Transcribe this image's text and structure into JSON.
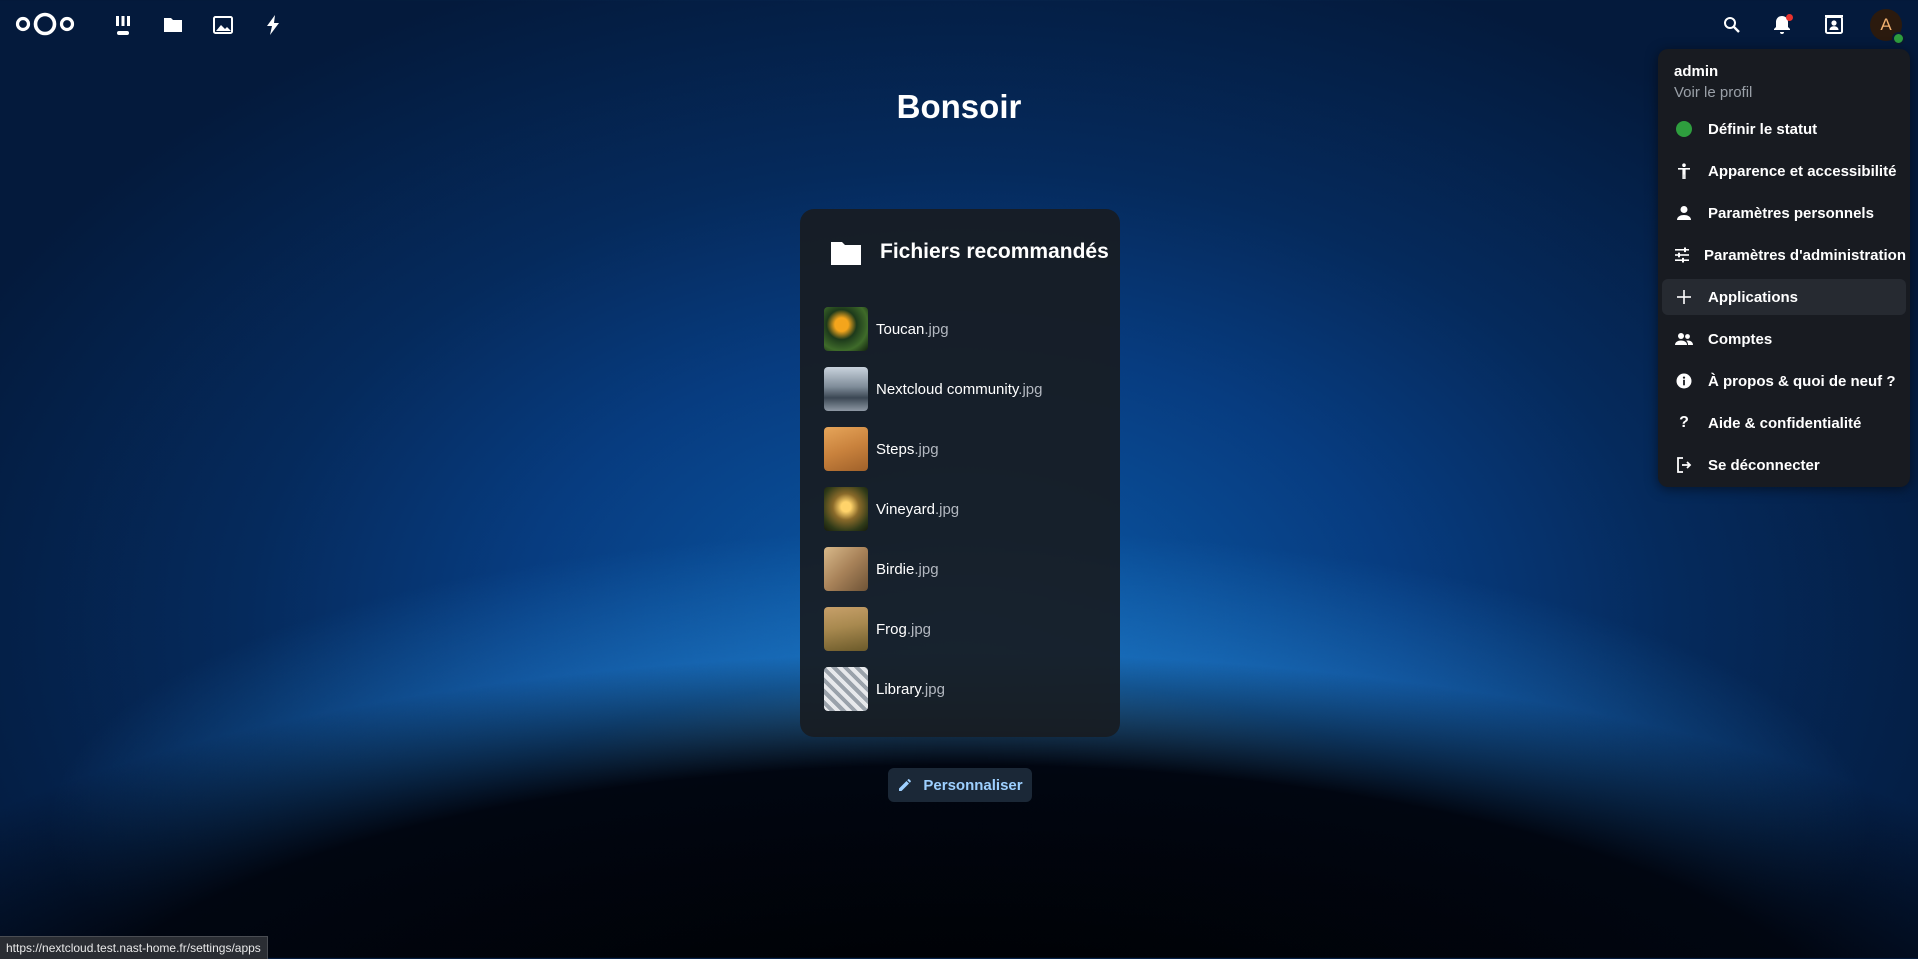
{
  "topbar": {
    "nav": [
      {
        "name": "dashboard-icon"
      },
      {
        "name": "files-icon"
      },
      {
        "name": "photos-icon"
      },
      {
        "name": "activity-icon"
      }
    ],
    "right": [
      {
        "name": "search-icon"
      },
      {
        "name": "notifications-icon"
      },
      {
        "name": "contacts-icon"
      }
    ],
    "avatar_letter": "A"
  },
  "greeting": "Bonsoir",
  "recommended": {
    "title": "Fichiers recommandés",
    "files": [
      {
        "name": "Toucan",
        "ext": ".jpg"
      },
      {
        "name": "Nextcloud community",
        "ext": ".jpg"
      },
      {
        "name": "Steps",
        "ext": ".jpg"
      },
      {
        "name": "Vineyard",
        "ext": ".jpg"
      },
      {
        "name": "Birdie",
        "ext": ".jpg"
      },
      {
        "name": "Frog",
        "ext": ".jpg"
      },
      {
        "name": "Library",
        "ext": ".jpg"
      }
    ]
  },
  "customize_label": "Personnaliser",
  "user_menu": {
    "username": "admin",
    "view_profile": "Voir le profil",
    "items": [
      {
        "label": "Définir le statut",
        "icon": "status-dot-icon",
        "status_color": "#2e9e3e"
      },
      {
        "label": "Apparence et accessibilité",
        "icon": "accessibility-icon"
      },
      {
        "label": "Paramètres personnels",
        "icon": "person-icon"
      },
      {
        "label": "Paramètres d'administration",
        "icon": "sliders-icon"
      },
      {
        "label": "Applications",
        "icon": "plus-icon",
        "highlighted": true
      },
      {
        "label": "Comptes",
        "icon": "accounts-icon"
      },
      {
        "label": "À propos & quoi de neuf ?",
        "icon": "info-icon"
      },
      {
        "label": "Aide & confidentialité",
        "icon": "help-icon"
      },
      {
        "label": "Se déconnecter",
        "icon": "logout-icon"
      }
    ]
  },
  "status_bar_url": "https://nextcloud.test.nast-home.fr/settings/apps"
}
